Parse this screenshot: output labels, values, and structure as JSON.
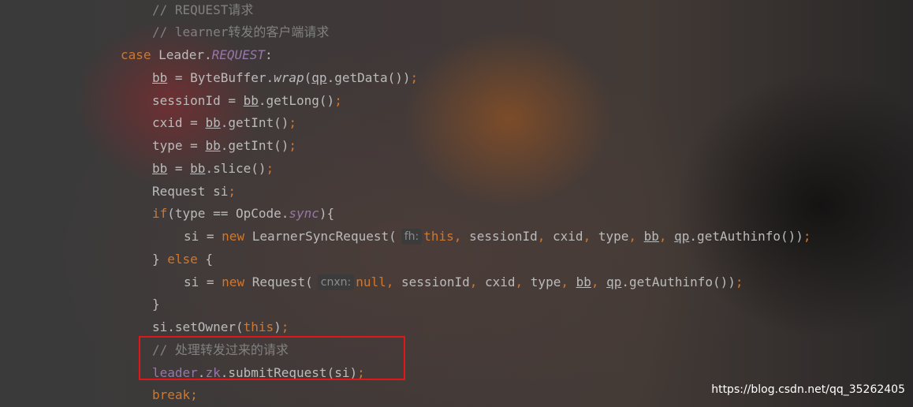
{
  "code": {
    "l1_comment": "// REQUEST请求",
    "l2_comment": "// learner转发的客户端请求",
    "l3_case": "case",
    "l3_leader": " Leader.",
    "l3_request": "REQUEST",
    "l3_colon": ":",
    "l4_bb": "bb",
    "l4_eq": " = ByteBuffer.",
    "l4_wrap": "wrap",
    "l4_open": "(",
    "l4_qp": "qp",
    "l4_rest": ".getData())",
    "l4_semi": ";",
    "l5_a": "sessionId = ",
    "l5_bb": "bb",
    "l5_rest": ".getLong()",
    "l5_semi": ";",
    "l6_a": "cxid = ",
    "l6_bb": "bb",
    "l6_rest": ".getInt()",
    "l6_semi": ";",
    "l7_a": "type = ",
    "l7_bb": "bb",
    "l7_rest": ".getInt()",
    "l7_semi": ";",
    "l8_bb1": "bb",
    "l8_eq": " = ",
    "l8_bb2": "bb",
    "l8_rest": ".slice()",
    "l8_semi": ";",
    "l9_a": "Request si",
    "l9_semi": ";",
    "l10_if": "if",
    "l10_a": "(type == OpCode.",
    "l10_sync": "sync",
    "l10_b": "){",
    "l11_a": "si = ",
    "l11_new": "new",
    "l11_b": " LearnerSyncRequest(",
    "l11_hint": "fh:",
    "l11_this": "this",
    "l11_c1": ", ",
    "l11_sid": "sessionId",
    "l11_c2": ", ",
    "l11_cxid": "cxid",
    "l11_c3": ", ",
    "l11_type": "type",
    "l11_c4": ", ",
    "l11_bb": "bb",
    "l11_c5": ", ",
    "l11_qp": "qp",
    "l11_rest": ".getAuthinfo())",
    "l11_semi": ";",
    "l12_a": "} ",
    "l12_else": "else",
    "l12_b": " {",
    "l13_a": "si = ",
    "l13_new": "new",
    "l13_b": " Request(",
    "l13_hint": "cnxn:",
    "l13_null": "null",
    "l13_c1": ", ",
    "l13_sid": "sessionId",
    "l13_c2": ", ",
    "l13_cxid": "cxid",
    "l13_c3": ", ",
    "l13_type": "type",
    "l13_c4": ", ",
    "l13_bb": "bb",
    "l13_c5": ", ",
    "l13_qp": "qp",
    "l13_rest": ".getAuthinfo())",
    "l13_semi": ";",
    "l14": "}",
    "l15_a": "si.setOwner(",
    "l15_this": "this",
    "l15_b": ")",
    "l15_semi": ";",
    "l16_comment": "// 处理转发过来的请求",
    "l17_leader": "leader",
    "l17_dot": ".",
    "l17_zk": "zk",
    "l17_rest": ".submitRequest(si)",
    "l17_semi": ";",
    "l18_break": "break",
    "l18_semi": ";"
  },
  "watermark": "https://blog.csdn.net/qq_35262405",
  "colors": {
    "keyword": "#cc7832",
    "comment": "#808080",
    "field": "#9876aa",
    "text": "#bbbbbb",
    "highlight_box": "#e0161b"
  }
}
